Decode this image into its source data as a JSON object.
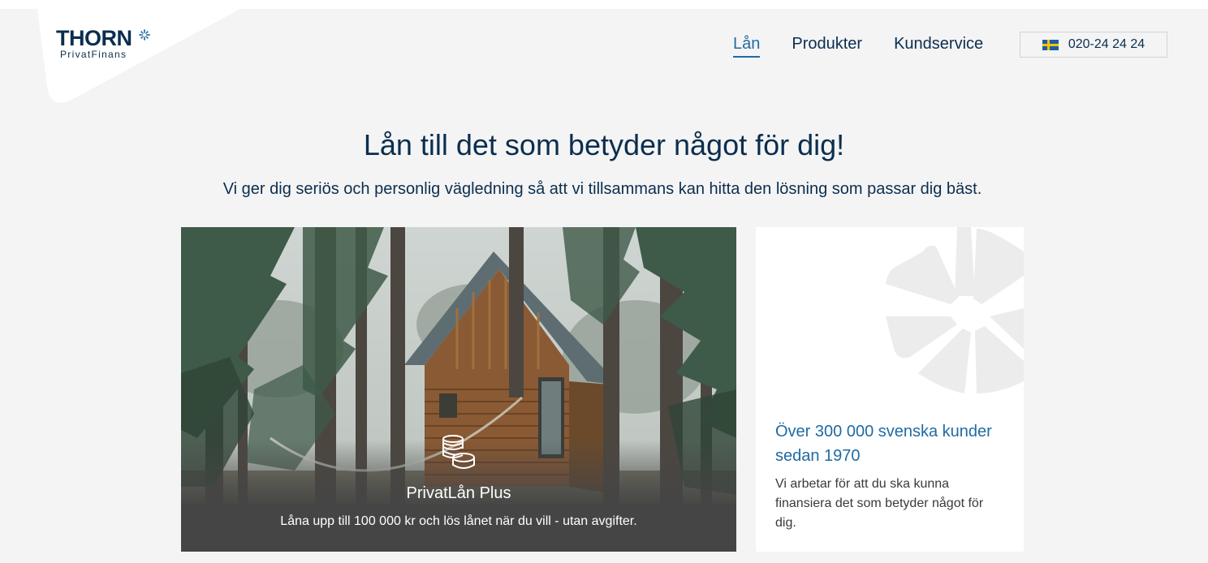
{
  "logo": {
    "brand": "THORN",
    "tagline": "PrivatFinans",
    "icon": "snowflake-icon"
  },
  "nav": {
    "items": [
      {
        "label": "Lån",
        "active": true
      },
      {
        "label": "Produkter",
        "active": false
      },
      {
        "label": "Kundservice",
        "active": false
      }
    ],
    "phone": "020-24 24 24",
    "phone_icon": "swedish-flag-icon"
  },
  "hero": {
    "headline": "Lån till det som betyder något för dig!",
    "subheadline": "Vi ger dig seriös och personlig vägledning så att vi tillsammans kan hitta den lösning som passar dig bäst."
  },
  "product_card": {
    "icon": "coins-icon",
    "title": "PrivatLån Plus",
    "description": "Låna upp till 100 000 kr och lös lånet när du vill - utan avgifter."
  },
  "info_card": {
    "title": "Över 300 000 svenska kunder sedan 1970",
    "text": "Vi arbetar för att du ska kunna finansiera det som betyder något för dig."
  },
  "colors": {
    "navy": "#0b2e4f",
    "accent_blue": "#1f6ba3",
    "page_bg": "#f4f4f4",
    "overlay": "#454545"
  }
}
